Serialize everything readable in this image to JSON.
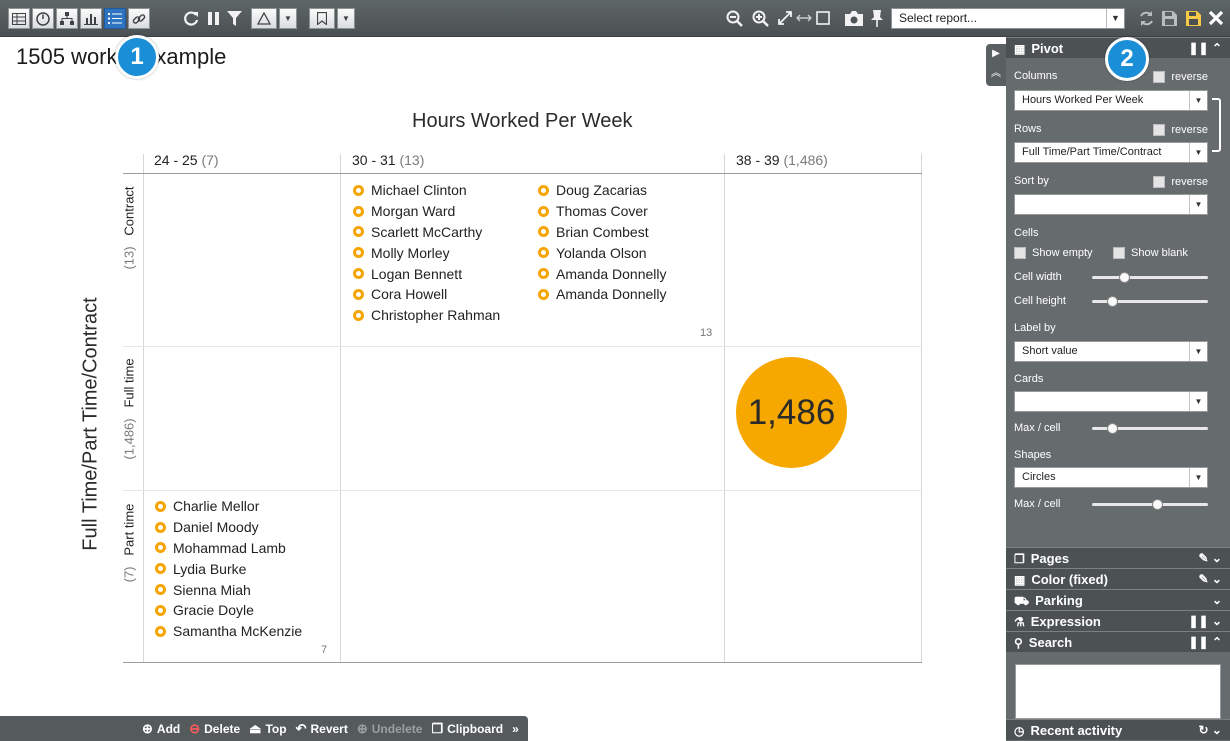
{
  "toolbar": {
    "view_icons": [
      "table-icon",
      "dashboard-icon",
      "hierarchy-icon",
      "bar-chart-icon",
      "list-icon",
      "link-icon"
    ],
    "active_view": "list-icon",
    "report_select": "Select report..."
  },
  "view_title": "1505 worker example",
  "badges": {
    "one": "1",
    "two": "2"
  },
  "pivot": {
    "column_field": "Hours Worked Per Week",
    "row_field": "Full Time/Part Time/Contract",
    "columns": [
      {
        "label": "24 - 25",
        "count": "(7)"
      },
      {
        "label": "30 - 31",
        "count": "(13)"
      },
      {
        "label": "38 - 39",
        "count": "(1,486)"
      }
    ],
    "rows": [
      {
        "label": "Contract",
        "count": "(13)"
      },
      {
        "label": "Full time",
        "count": "(1,486)"
      },
      {
        "label": "Part time",
        "count": "(7)"
      }
    ],
    "contract_30_list_a": [
      "Michael Clinton",
      "Morgan Ward",
      "Scarlett McCarthy",
      "Molly Morley",
      "Logan Bennett",
      "Cora Howell",
      "Christopher Rahman"
    ],
    "contract_30_list_b": [
      "Doug Zacarias",
      "Thomas Cover",
      "Brian Combest",
      "Yolanda Olson",
      "Amanda Donnelly",
      "Amanda Donnelly"
    ],
    "contract_30_total": "13",
    "fulltime_38_bubble": "1,486",
    "parttime_24_list": [
      "Charlie Mellor",
      "Daniel Moody",
      "Mohammad Lamb",
      "Lydia Burke",
      "Sienna Miah",
      "Gracie Doyle",
      "Samantha McKenzie"
    ],
    "parttime_24_total": "7"
  },
  "actions": [
    {
      "label": "Add",
      "icon": "plus-circle-icon",
      "enabled": true
    },
    {
      "label": "Delete",
      "icon": "minus-circle-icon",
      "enabled": true
    },
    {
      "label": "Top",
      "icon": "eject-icon",
      "enabled": true
    },
    {
      "label": "Revert",
      "icon": "undo-icon",
      "enabled": true
    },
    {
      "label": "Undelete",
      "icon": "plus-circle-icon",
      "enabled": false
    },
    {
      "label": "Clipboard",
      "icon": "clipboard-icon",
      "enabled": true
    }
  ],
  "panel": {
    "pivot_header": "Pivot",
    "columns_label": "Columns",
    "reverse_label": "reverse",
    "columns_value": "Hours Worked Per Week",
    "rows_label": "Rows",
    "rows_value": "Full Time/Part Time/Contract",
    "sort_label": "Sort by",
    "sort_value": "",
    "cells_label": "Cells",
    "show_empty": "Show empty",
    "show_blank": "Show blank",
    "cell_width": "Cell width",
    "cell_width_level": 0.28,
    "cell_height": "Cell height",
    "cell_height_level": 0.17,
    "label_by": "Label by",
    "label_by_value": "Short value",
    "cards_label": "Cards",
    "cards_value": "",
    "max_per_cell": "Max / cell",
    "cards_max_level": 0.17,
    "shapes_label": "Shapes",
    "shapes_value": "Circles",
    "shapes_max_level": 0.56,
    "pages": "Pages",
    "color": "Color (fixed)",
    "parking": "Parking",
    "expression": "Expression",
    "search": "Search",
    "recent_activity": "Recent activity"
  },
  "colors": {
    "accent": "#f5a400",
    "badge": "#1a8fd8",
    "panel": "#666c6e",
    "toolbar": "#555b5d"
  }
}
